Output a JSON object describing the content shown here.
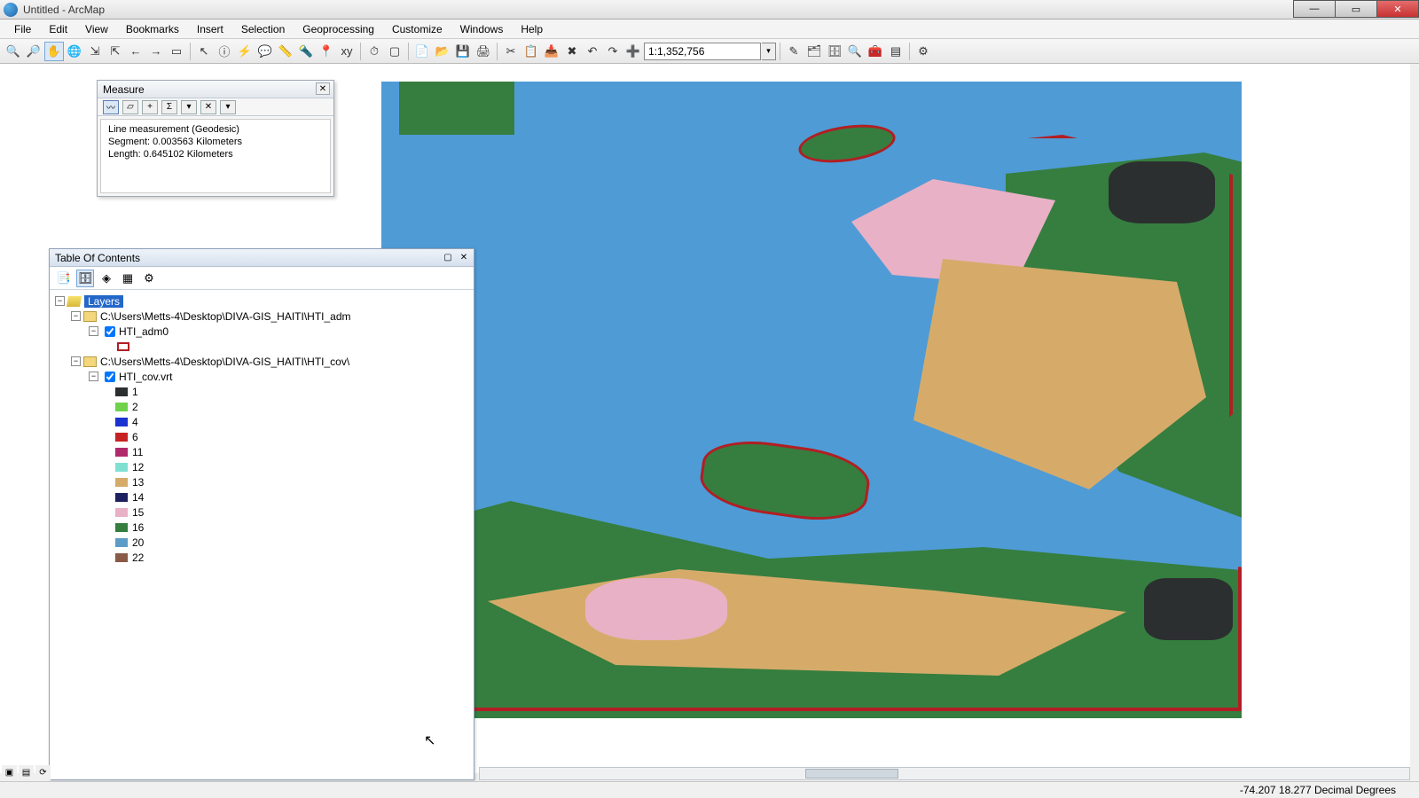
{
  "window": {
    "title": "Untitled - ArcMap"
  },
  "menu": [
    "File",
    "Edit",
    "View",
    "Bookmarks",
    "Insert",
    "Selection",
    "Geoprocessing",
    "Customize",
    "Windows",
    "Help"
  ],
  "scale": "1:1,352,756",
  "measure": {
    "title": "Measure",
    "line1": "Line measurement (Geodesic)",
    "line2": "Segment: 0.003563 Kilometers",
    "line3": "Length: 0.645102 Kilometers"
  },
  "toc": {
    "title": "Table Of Contents",
    "layers_label": "Layers",
    "group1_path": "C:\\Users\\Metts-4\\Desktop\\DIVA-GIS_HAITI\\HTI_adm",
    "layer1_name": "HTI_adm0",
    "group2_path": "C:\\Users\\Metts-4\\Desktop\\DIVA-GIS_HAITI\\HTI_cov\\",
    "layer2_name": "HTI_cov.vrt",
    "legend": [
      {
        "v": "1",
        "c": "#2b2f2f"
      },
      {
        "v": "2",
        "c": "#6fd24a"
      },
      {
        "v": "4",
        "c": "#1a33d0"
      },
      {
        "v": "6",
        "c": "#c72222"
      },
      {
        "v": "11",
        "c": "#b02a6a"
      },
      {
        "v": "12",
        "c": "#7fe0d2"
      },
      {
        "v": "13",
        "c": "#d6ab6a"
      },
      {
        "v": "14",
        "c": "#1e2160"
      },
      {
        "v": "15",
        "c": "#e9b1c5"
      },
      {
        "v": "16",
        "c": "#357e3f"
      },
      {
        "v": "20",
        "c": "#5e9cc8"
      },
      {
        "v": "22",
        "c": "#8a5a48"
      }
    ]
  },
  "status": {
    "coords": "-74.207  18.277 Decimal Degrees"
  }
}
